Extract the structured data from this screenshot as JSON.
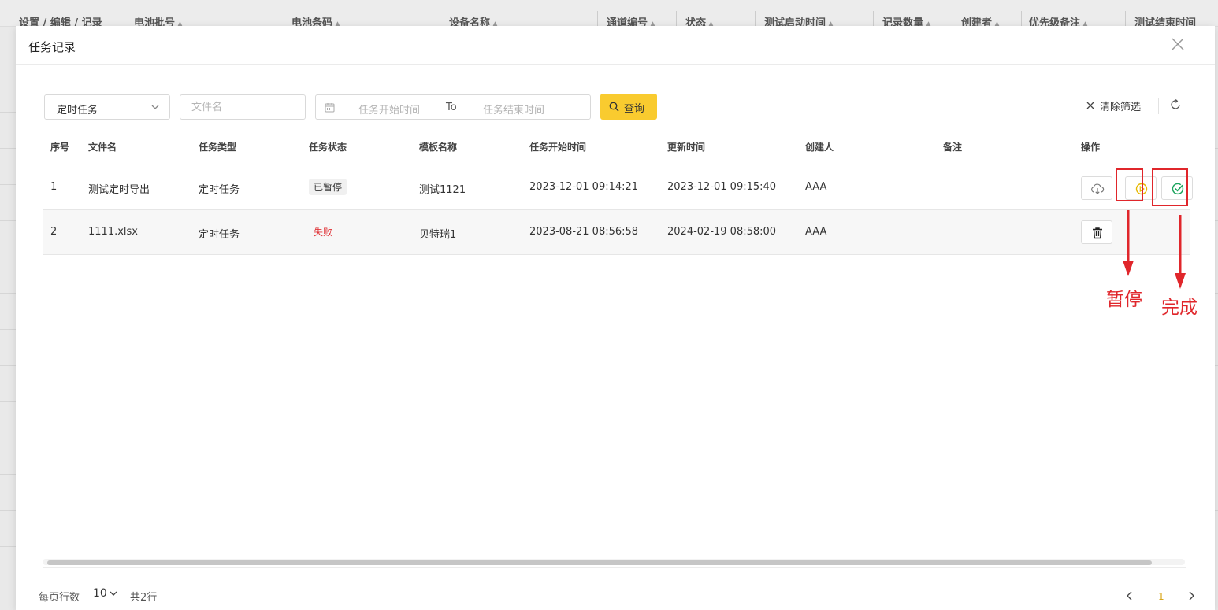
{
  "background": {
    "columns": [
      "设置 / 编辑 / 记录",
      "电池批号",
      "电池条码",
      "设备名称",
      "通道编号",
      "状态",
      "测试启动时间",
      "记录数量",
      "创建者",
      "优先级备注",
      "测试结束时间"
    ]
  },
  "modal": {
    "title": "任务记录"
  },
  "filters": {
    "task_type_value": "定时任务",
    "filename_placeholder": "文件名",
    "start_placeholder": "任务开始时间",
    "to_label": "To",
    "end_placeholder": "任务结束时间",
    "query_label": "查询",
    "clear_label": "清除筛选"
  },
  "table": {
    "headers": [
      "序号",
      "文件名",
      "任务类型",
      "任务状态",
      "模板名称",
      "任务开始时间",
      "更新时间",
      "创建人",
      "备注",
      "操作"
    ],
    "rows": [
      {
        "index": "1",
        "filename": "测试定时导出",
        "type": "定时任务",
        "status": "已暂停",
        "template": "测试1121",
        "start_time": "2023-12-01 09:14:21",
        "update_time": "2023-12-01 09:15:40",
        "creator": "AAA",
        "note": ""
      },
      {
        "index": "2",
        "filename": "1111.xlsx",
        "type": "定时任务",
        "status": "失败",
        "template": "贝特瑞1",
        "start_time": "2023-08-21 08:56:58",
        "update_time": "2024-02-19 08:58:00",
        "creator": "AAA",
        "note": ""
      }
    ]
  },
  "annotations": {
    "pause_label": "暂停",
    "complete_label": "完成"
  },
  "pagination": {
    "rows_per_page_label": "每页行数",
    "page_size": "10",
    "total": "共2行",
    "current_page": "1"
  },
  "colors": {
    "accent": "#f9cb2f",
    "annotation": "#e0262b",
    "failed": "#e0363a",
    "complete_icon": "#1aa35c"
  }
}
